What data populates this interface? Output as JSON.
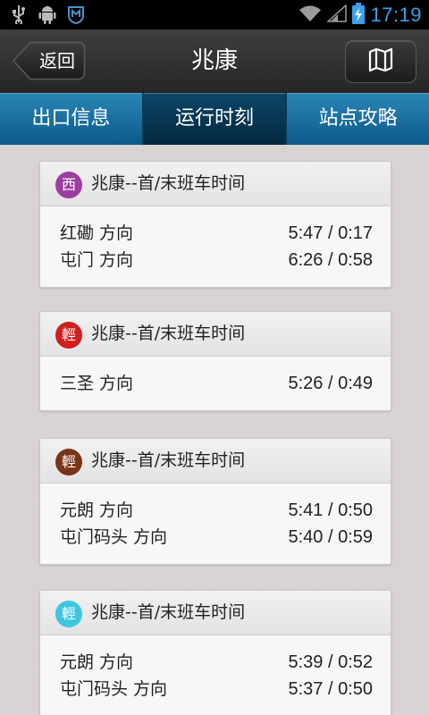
{
  "status_bar": {
    "time": "17:19",
    "icons": [
      "usb-icon",
      "android-debug-icon",
      "app-notification-icon",
      "wifi-icon",
      "signal-icon",
      "battery-charging-icon"
    ]
  },
  "header": {
    "back_label": "返回",
    "title": "兆康",
    "map_icon": "map-icon"
  },
  "tabs": [
    {
      "label": "出口信息",
      "active": false
    },
    {
      "label": "运行时刻",
      "active": true
    },
    {
      "label": "站点攻略",
      "active": false
    }
  ],
  "cards": [
    {
      "badge": "西",
      "badge_color": "#9b3ea0",
      "title": "兆康--首/末班车时间",
      "rows": [
        {
          "direction": "红磡  方向",
          "time": "5:47 / 0:17"
        },
        {
          "direction": "屯门  方向",
          "time": "6:26 / 0:58"
        }
      ]
    },
    {
      "badge": "輕",
      "badge_color": "#d11f1f",
      "title": "兆康--首/末班车时间",
      "rows": [
        {
          "direction": "三圣  方向",
          "time": "5:26 / 0:49"
        }
      ]
    },
    {
      "badge": "輕",
      "badge_color": "#7a3417",
      "title": "兆康--首/末班车时间",
      "rows": [
        {
          "direction": "元朗  方向",
          "time": "5:41 / 0:50"
        },
        {
          "direction": "屯门码头  方向",
          "time": "5:40 / 0:59"
        }
      ]
    },
    {
      "badge": "輕",
      "badge_color": "#3ec6e0",
      "title": "兆康--首/末班车时间",
      "rows": [
        {
          "direction": "元朗  方向",
          "time": "5:39 / 0:52"
        },
        {
          "direction": "屯门码头  方向",
          "time": "5:37 / 0:50"
        }
      ]
    }
  ]
}
